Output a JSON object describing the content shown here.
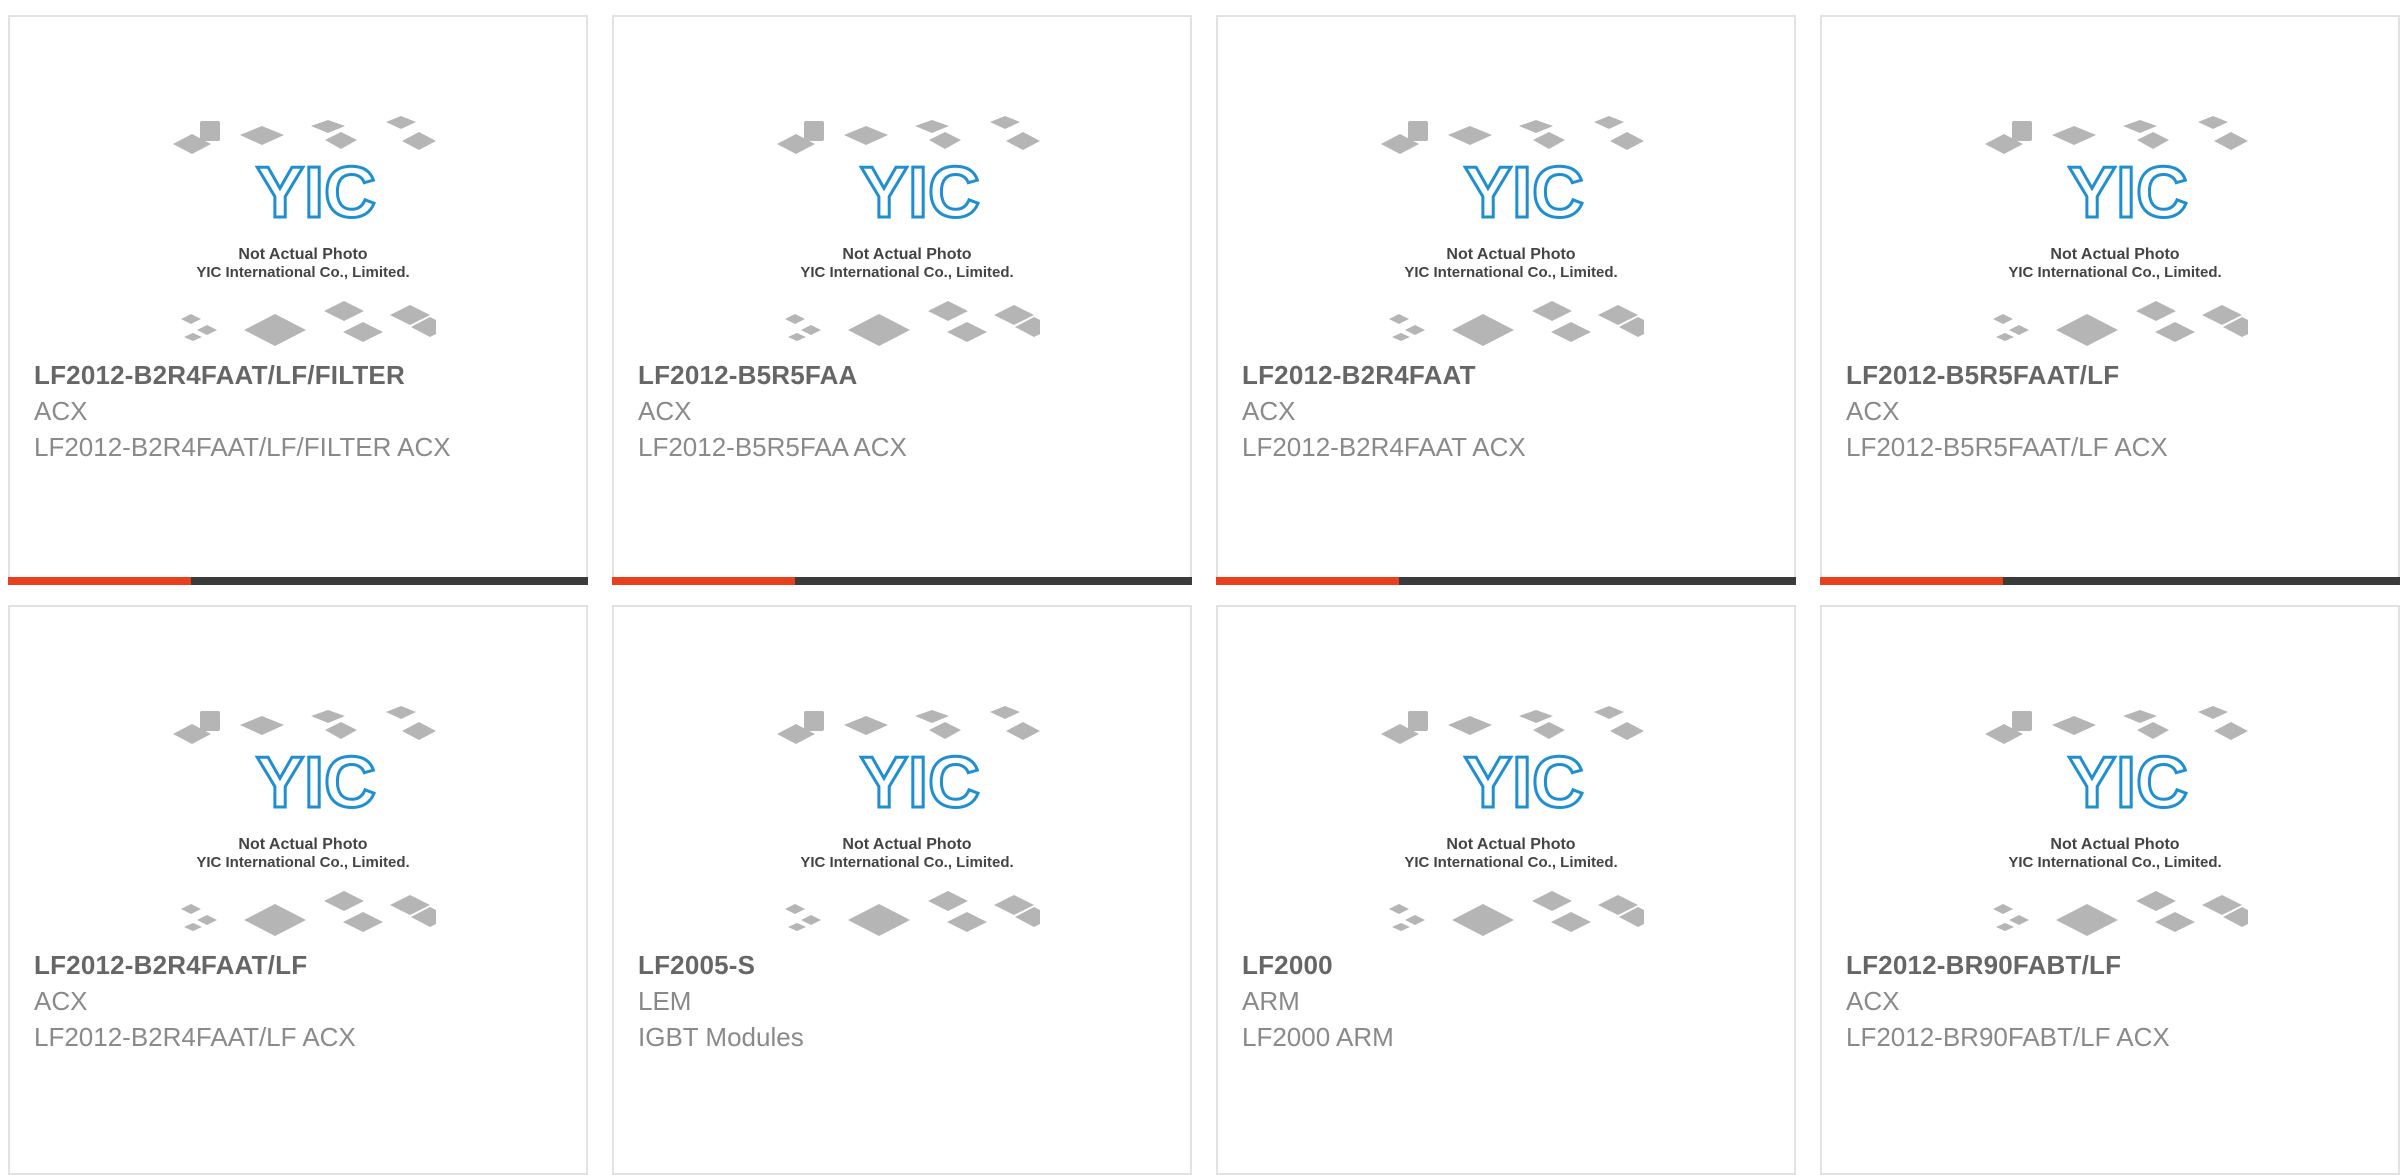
{
  "placeholder": {
    "logo_text": "YIC",
    "caption_line1": "Not Actual Photo",
    "caption_line2": "YIC International Co., Limited."
  },
  "colors": {
    "accent": "#e8401c",
    "bar": "#3b3b3b",
    "logo_blue": "#1f8fd1",
    "border": "#e2e2e2",
    "title_text": "#666666",
    "body_text": "#8a8a8a"
  },
  "products": [
    {
      "part": "LF2012-B2R4FAAT/LF/FILTER",
      "maker": "ACX",
      "desc": "LF2012-B2R4FAAT/LF/FILTER ACX"
    },
    {
      "part": "LF2012-B5R5FAA",
      "maker": "ACX",
      "desc": "LF2012-B5R5FAA ACX"
    },
    {
      "part": "LF2012-B2R4FAAT",
      "maker": "ACX",
      "desc": "LF2012-B2R4FAAT ACX"
    },
    {
      "part": "LF2012-B5R5FAAT/LF",
      "maker": "ACX",
      "desc": "LF2012-B5R5FAAT/LF ACX"
    },
    {
      "part": "LF2012-B2R4FAAT/LF",
      "maker": "ACX",
      "desc": "LF2012-B2R4FAAT/LF ACX"
    },
    {
      "part": "LF2005-S",
      "maker": "LEM",
      "desc": "IGBT Modules"
    },
    {
      "part": "LF2000",
      "maker": "ARM",
      "desc": "LF2000 ARM"
    },
    {
      "part": "LF2012-BR90FABT/LF",
      "maker": "ACX",
      "desc": "LF2012-BR90FABT/LF ACX"
    }
  ]
}
